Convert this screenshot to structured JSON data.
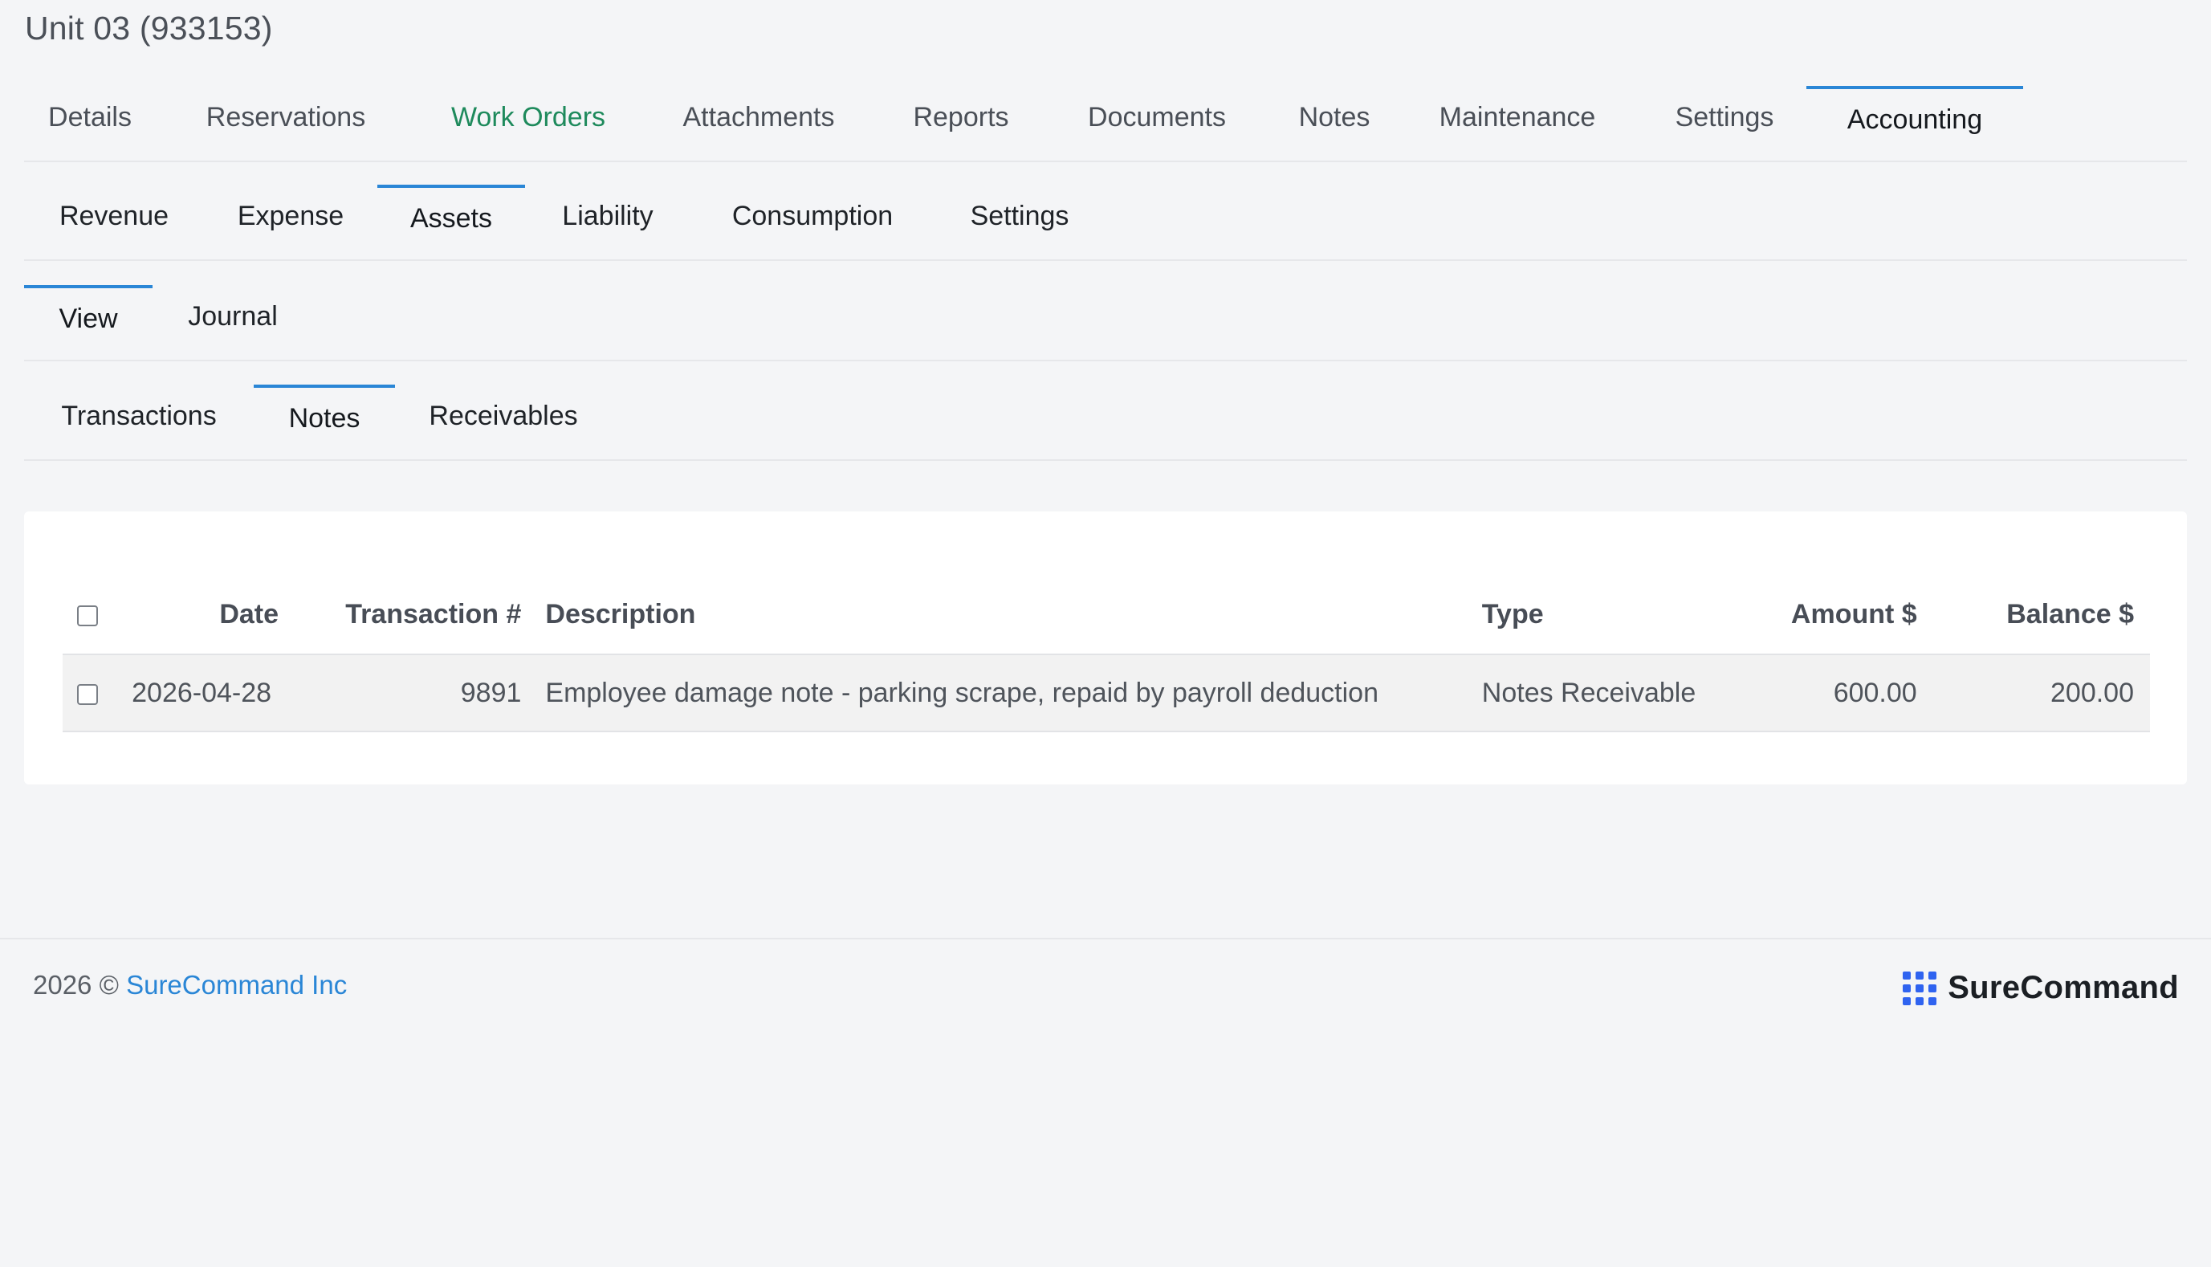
{
  "page_title": "Unit 03 (933153)",
  "tabs_level1": {
    "details": "Details",
    "reservations": "Reservations",
    "work_orders": "Work Orders",
    "attachments": "Attachments",
    "reports": "Reports",
    "documents": "Documents",
    "notes": "Notes",
    "maintenance": "Maintenance",
    "settings": "Settings",
    "accounting": "Accounting"
  },
  "tabs_level2": {
    "revenue": "Revenue",
    "expense": "Expense",
    "assets": "Assets",
    "liability": "Liability",
    "consumption": "Consumption",
    "settings": "Settings"
  },
  "tabs_level3": {
    "view": "View",
    "journal": "Journal"
  },
  "tabs_level4": {
    "transactions": "Transactions",
    "notes": "Notes",
    "receivables": "Receivables"
  },
  "table": {
    "headers": {
      "date": "Date",
      "transaction": "Transaction #",
      "description": "Description",
      "type": "Type",
      "amount": "Amount $",
      "balance": "Balance $"
    },
    "rows": [
      {
        "date": "2026-04-28",
        "transaction": "9891",
        "description": "Employee damage note - parking scrape, repaid by payroll deduction",
        "type": "Notes Receivable",
        "amount": "600.00",
        "balance": "200.00"
      }
    ]
  },
  "footer": {
    "copyright": "2026 ©",
    "company_link": "SureCommand Inc",
    "brand_name": "SureCommand"
  },
  "colors": {
    "accent": "#2a86d6",
    "green_tab": "#1e8a5c",
    "brand_blue": "#2f63f0"
  }
}
